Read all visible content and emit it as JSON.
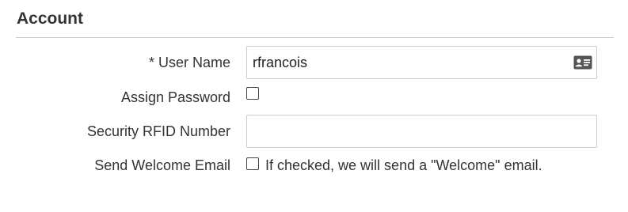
{
  "section": {
    "title": "Account"
  },
  "fields": {
    "username": {
      "label": "* User Name",
      "value": "rfrancois",
      "icon": "contact-card-icon"
    },
    "assign_password": {
      "label": "Assign Password",
      "checked": false
    },
    "security_rfid": {
      "label": "Security RFID Number",
      "value": ""
    },
    "send_welcome_email": {
      "label": "Send Welcome Email",
      "checked": false,
      "help_text": "If checked, we will send a \"Welcome\" email."
    }
  },
  "colors": {
    "text": "#333333",
    "border": "#cccccc",
    "divider": "#cccccc"
  }
}
